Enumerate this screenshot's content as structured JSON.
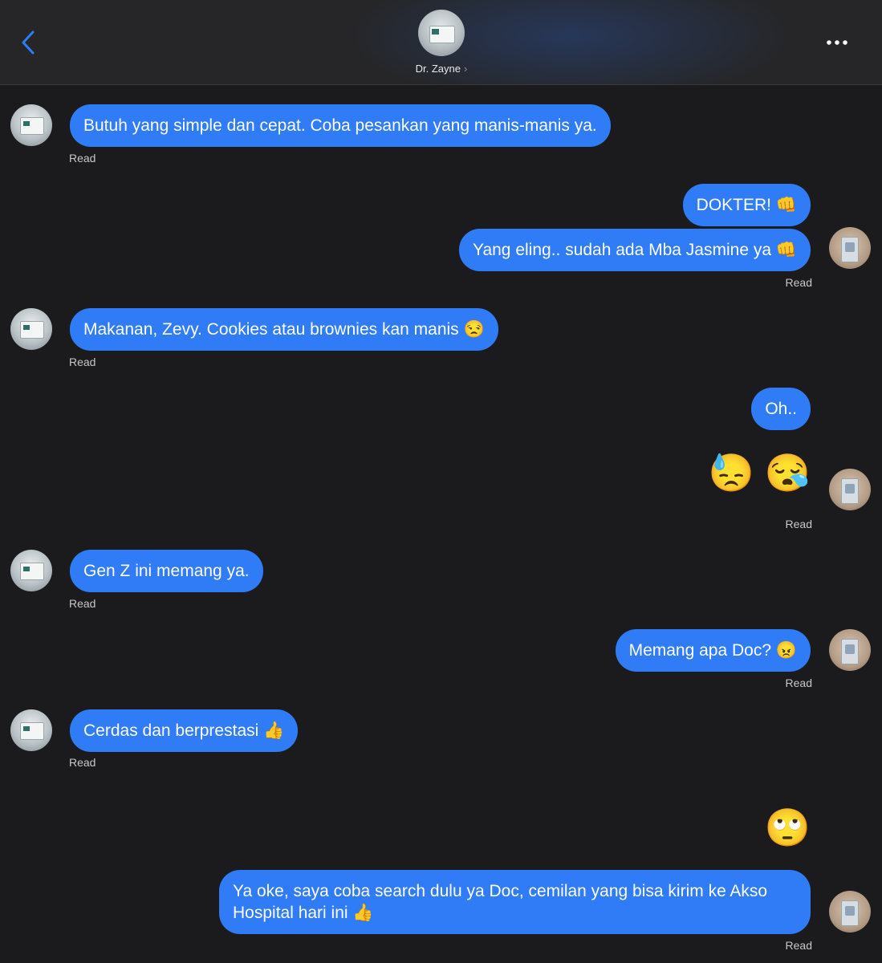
{
  "header": {
    "contact_name": "Dr. Zayne",
    "chevron": "›",
    "back_icon": "chevron-left-icon",
    "more_icon": "ellipsis-icon",
    "accent_color": "#2f7cf6"
  },
  "messages": [
    {
      "sender": "Dr. Zayne",
      "text": "Butuh yang simple dan cepat. Coba pesankan yang manis-manis ya.",
      "status": "Read"
    },
    {
      "sender": "me",
      "text": "DOKTER! 👊"
    },
    {
      "sender": "me",
      "text": "Yang eling.. sudah ada Mba Jasmine ya 👊",
      "status": "Read"
    },
    {
      "sender": "Dr. Zayne",
      "text": "Makanan, Zevy. Cookies atau brownies kan manis 😒",
      "status": "Read"
    },
    {
      "sender": "me",
      "text": "Oh.."
    },
    {
      "sender": "me",
      "text": "😓 😪",
      "status": "Read"
    },
    {
      "sender": "Dr. Zayne",
      "text": "Gen Z ini memang ya.",
      "status": "Read"
    },
    {
      "sender": "me",
      "text": "Memang apa Doc? 😠",
      "status": "Read"
    },
    {
      "sender": "Dr. Zayne",
      "text": "Cerdas dan berprestasi 👍",
      "status": "Read"
    },
    {
      "sender": "me",
      "text": "🙄"
    },
    {
      "sender": "me",
      "text": "Ya oke, saya coba search dulu ya Doc, cemilan yang bisa kirim ke Akso Hospital hari ini 👍",
      "status": "Read"
    }
  ]
}
